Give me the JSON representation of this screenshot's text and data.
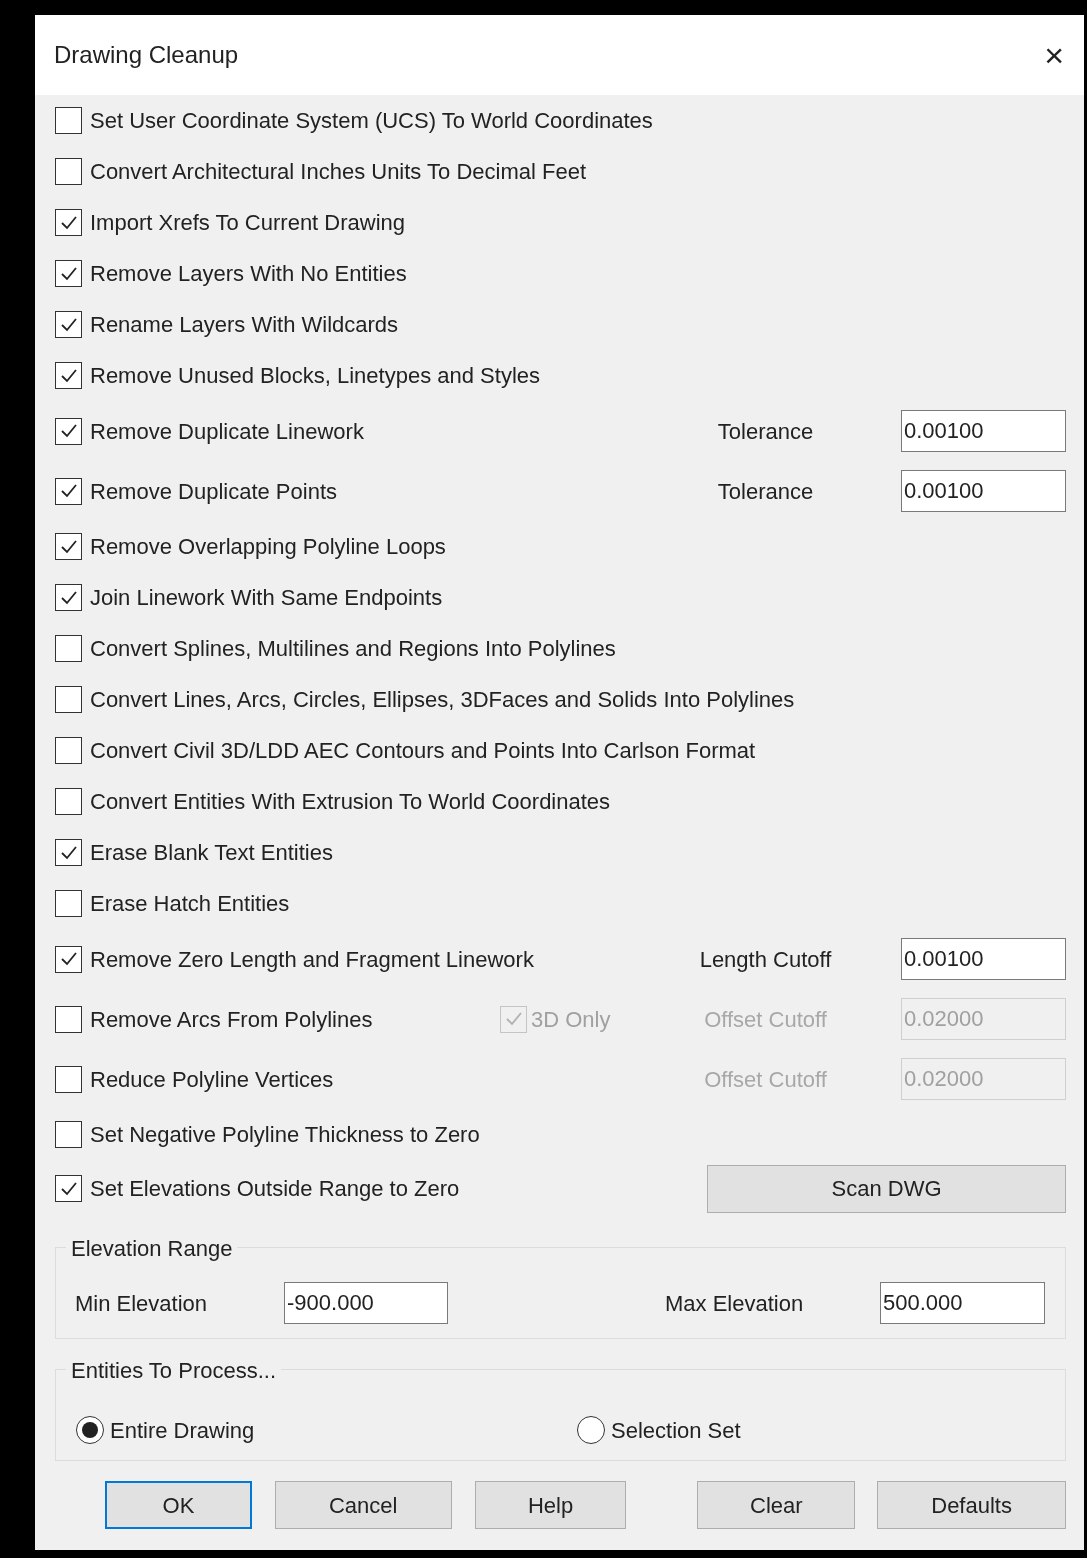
{
  "window": {
    "title": "Drawing Cleanup",
    "close": "×"
  },
  "options": [
    {
      "kind": "plain",
      "label": "Set User Coordinate System (UCS) To World Coordinates",
      "checked": false
    },
    {
      "kind": "plain",
      "label": "Convert Architectural Inches Units To Decimal Feet",
      "checked": false
    },
    {
      "kind": "plain",
      "label": "Import Xrefs To Current Drawing",
      "checked": true
    },
    {
      "kind": "plain",
      "label": "Remove Layers With No Entities",
      "checked": true
    },
    {
      "kind": "plain",
      "label": "Rename Layers With Wildcards",
      "checked": true
    },
    {
      "kind": "plain",
      "label": "Remove Unused Blocks, Linetypes and Styles",
      "checked": true
    },
    {
      "kind": "field",
      "label": "Remove Duplicate Linework",
      "checked": true,
      "field_label": "Tolerance",
      "value": "0.00100",
      "disabled": false
    },
    {
      "kind": "field",
      "label": "Remove Duplicate Points",
      "checked": true,
      "field_label": "Tolerance",
      "value": "0.00100",
      "disabled": false
    },
    {
      "kind": "plain",
      "label": "Remove Overlapping Polyline Loops",
      "checked": true
    },
    {
      "kind": "plain",
      "label": "Join Linework With Same Endpoints",
      "checked": true
    },
    {
      "kind": "plain",
      "label": "Convert Splines, Multilines and Regions Into Polylines",
      "checked": false
    },
    {
      "kind": "plain",
      "label": "Convert Lines, Arcs, Circles, Ellipses, 3DFaces and Solids Into Polylines",
      "checked": false
    },
    {
      "kind": "plain",
      "label": "Convert Civil 3D/LDD AEC Contours and Points Into Carlson Format",
      "checked": false
    },
    {
      "kind": "plain",
      "label": "Convert Entities With Extrusion To World Coordinates",
      "checked": false
    },
    {
      "kind": "plain",
      "label": "Erase Blank Text Entities",
      "checked": true
    },
    {
      "kind": "plain",
      "label": "Erase Hatch Entities",
      "checked": false
    },
    {
      "kind": "field",
      "label": "Remove Zero Length and Fragment Linework",
      "checked": true,
      "field_label": "Length Cutoff",
      "value": "0.00100",
      "disabled": false
    },
    {
      "kind": "sub",
      "label": "Remove Arcs From Polylines",
      "checked": false,
      "sub_label": "3D Only",
      "sub_checked": true,
      "field_label": "Offset Cutoff",
      "value": "0.02000",
      "disabled": true
    },
    {
      "kind": "field",
      "label": "Reduce Polyline Vertices",
      "checked": false,
      "field_label": "Offset Cutoff",
      "value": "0.02000",
      "disabled": true
    },
    {
      "kind": "plain",
      "label": "Set Negative Polyline Thickness to Zero",
      "checked": false
    },
    {
      "kind": "button",
      "label": "Set Elevations Outside Range to Zero",
      "checked": true,
      "button": "Scan DWG"
    }
  ],
  "elevation_range": {
    "title": "Elevation Range",
    "min_label": "Min Elevation",
    "min_value": "-900.000",
    "max_label": "Max Elevation",
    "max_value": "500.000"
  },
  "entities": {
    "title": "Entities To Process...",
    "options": [
      {
        "label": "Entire Drawing",
        "selected": true
      },
      {
        "label": "Selection Set",
        "selected": false
      }
    ]
  },
  "buttons": [
    {
      "label": "OK",
      "default": true
    },
    {
      "label": "Cancel",
      "default": false
    },
    {
      "label": "Help",
      "default": false
    },
    {
      "label": "Clear",
      "default": false
    },
    {
      "label": "Defaults",
      "default": false
    }
  ]
}
